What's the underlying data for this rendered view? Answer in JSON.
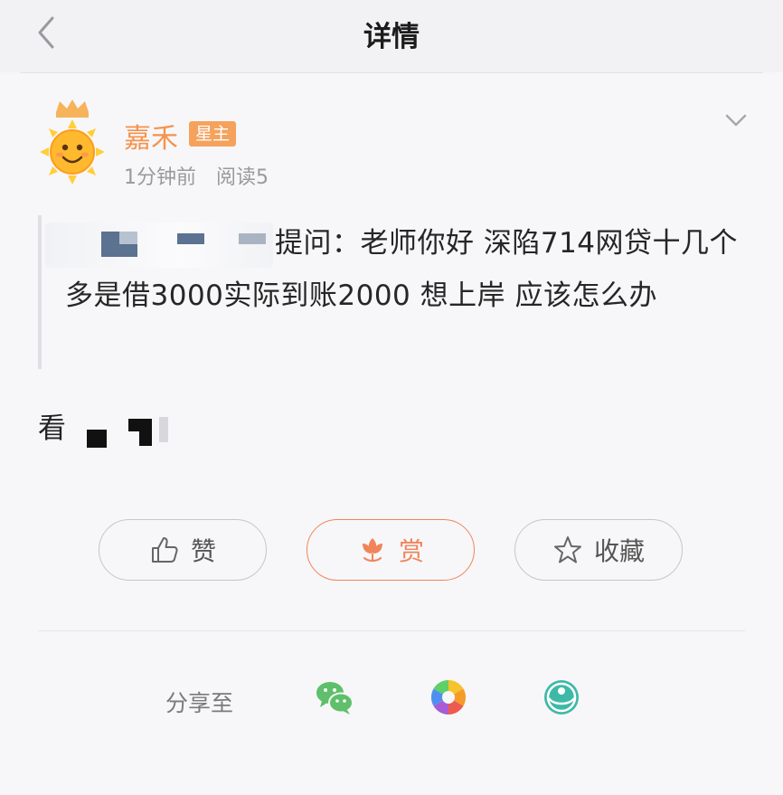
{
  "nav": {
    "title": "详情",
    "back_icon": "chevron-left-icon"
  },
  "author": {
    "name": "嘉禾",
    "badge": "星主",
    "time": "1分钟前",
    "reads": "阅读5",
    "avatar_icon": "sun-crown-avatar"
  },
  "post": {
    "quote": "提问：老师你好   深陷714网贷十几个多是借3000实际到账2000   想上岸   应该怎么办",
    "body_prefix": "看"
  },
  "actions": {
    "like_label": "赞",
    "reward_label": "赏",
    "favorite_label": "收藏"
  },
  "share": {
    "label": "分享至",
    "targets": [
      "wechat-icon",
      "moments-icon",
      "circle-icon"
    ]
  },
  "colors": {
    "accent": "#f5934c",
    "badge": "#f5a25c",
    "reward": "#f0855a",
    "wechat": "#5fbf6a",
    "teal": "#3fb9a7"
  }
}
